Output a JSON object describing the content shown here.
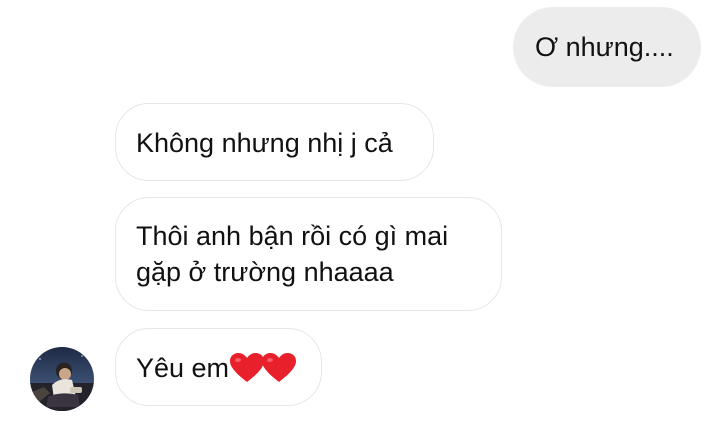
{
  "conversation": {
    "outgoing": [
      {
        "text": "Ơ nhưng...."
      }
    ],
    "incoming": [
      {
        "lines": [
          "Không nhưng nhị j cả"
        ]
      },
      {
        "lines": [
          "Thôi anh bận rồi có gì mai",
          "gặp ở trường nhaaaa"
        ]
      },
      {
        "lines": [
          "Yêu em"
        ],
        "trailing_icons": [
          "red-heart-icon",
          "red-heart-icon"
        ]
      }
    ]
  },
  "colors": {
    "outgoing_bubble": "#ececec",
    "incoming_bubble": "#ffffff",
    "incoming_border": "#e6e6e6",
    "text": "#111111",
    "heart": "#e8202c"
  }
}
